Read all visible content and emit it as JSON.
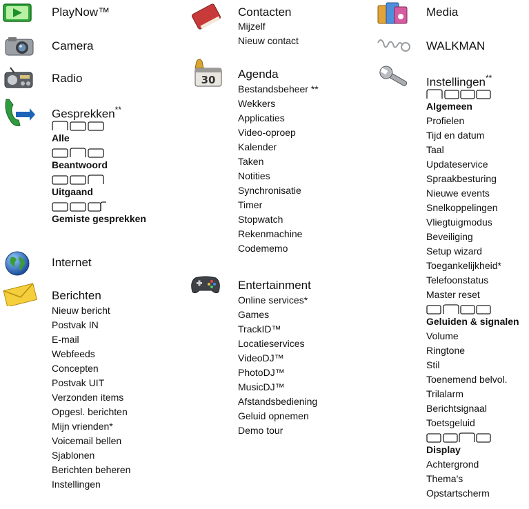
{
  "col1": {
    "playnow": "PlayNow™",
    "camera": "Camera",
    "radio": "Radio",
    "gesprekken": {
      "title": "Gesprekken",
      "mark": "**",
      "groups": [
        "Alle",
        "Beantwoord",
        "Uitgaand",
        "Gemiste gesprekken"
      ]
    },
    "internet": "Internet",
    "berichten": {
      "title": "Berichten",
      "items": [
        "Nieuw bericht",
        "Postvak IN",
        "E-mail",
        "Webfeeds",
        "Concepten",
        "Postvak UIT",
        "Verzonden items",
        "Opgesl. berichten",
        "Mijn vrienden*",
        "Voicemail bellen",
        "Sjablonen",
        "Berichten beheren",
        "Instellingen"
      ]
    }
  },
  "col2": {
    "contacten": {
      "title": "Contacten",
      "items": [
        "Mijzelf",
        "Nieuw contact"
      ]
    },
    "agenda": {
      "title": "Agenda",
      "items": [
        "Bestandsbeheer **",
        "Wekkers",
        "Applicaties",
        "Video-oproep",
        "Kalender",
        "Taken",
        "Notities",
        "Synchronisatie",
        "Timer",
        "Stopwatch",
        "Rekenmachine",
        "Codememo"
      ]
    },
    "entertainment": {
      "title": "Entertainment",
      "items": [
        "Online services*",
        "Games",
        "TrackID™",
        "Locatieservices",
        "VideoDJ™",
        "PhotoDJ™",
        "MusicDJ™",
        "Afstandsbediening",
        "Geluid opnemen",
        "Demo tour"
      ]
    }
  },
  "col3": {
    "media": "Media",
    "walkman": "WALKMAN",
    "instellingen": {
      "title": "Instellingen",
      "mark": "**",
      "algemeen": {
        "label": "Algemeen",
        "items": [
          "Profielen",
          "Tijd en datum",
          "Taal",
          "Updateservice",
          "Spraakbesturing",
          "Nieuwe events",
          "Snelkoppelingen",
          "Vliegtuigmodus",
          "Beveiliging",
          "Setup wizard",
          "Toegankelijkheid*",
          "Telefoonstatus",
          "Master reset"
        ]
      },
      "geluiden": {
        "label": "Geluiden & signalen",
        "items": [
          "Volume",
          "Ringtone",
          "Stil",
          "Toenemend belvol.",
          "Trilalarm",
          "Berichtsignaal",
          "Toetsgeluid"
        ]
      },
      "display": {
        "label": "Display",
        "items": [
          "Achtergrond",
          "Thema's",
          "Opstartscherm"
        ]
      }
    }
  }
}
